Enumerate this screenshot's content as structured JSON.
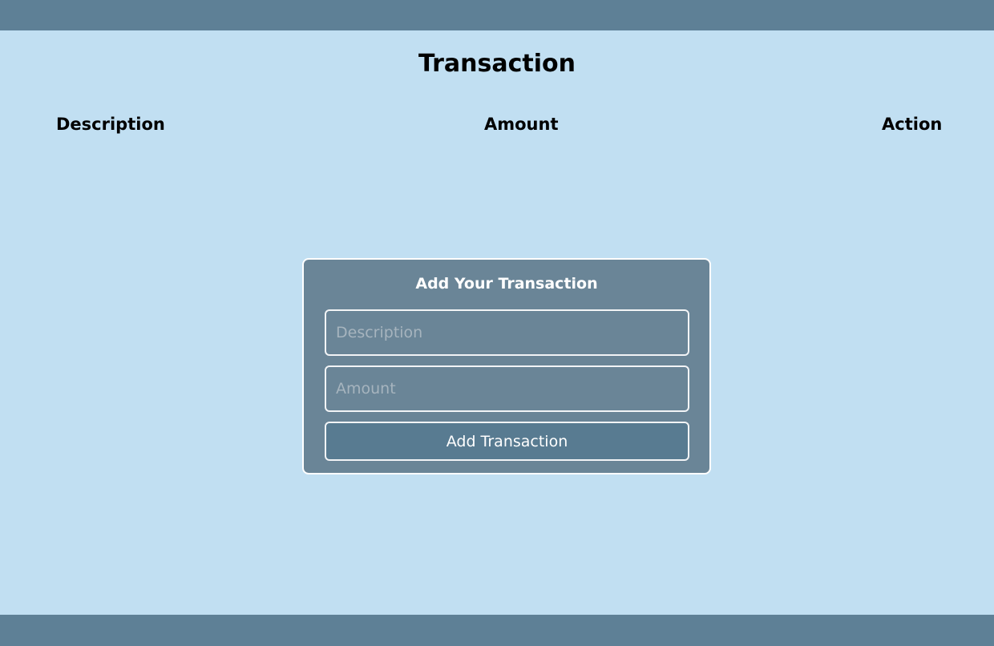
{
  "page": {
    "title": "Transaction"
  },
  "table": {
    "headers": [
      "Description",
      "Amount",
      "Action"
    ],
    "rows": []
  },
  "form": {
    "title": "Add Your Transaction",
    "description_placeholder": "Description",
    "description_value": "",
    "amount_placeholder": "Amount",
    "amount_value": "",
    "submit_label": "Add Transaction"
  },
  "colors": {
    "background": "#c1dff2",
    "bars": "#5e8096",
    "card": "#6a8597",
    "button": "#587b91"
  }
}
